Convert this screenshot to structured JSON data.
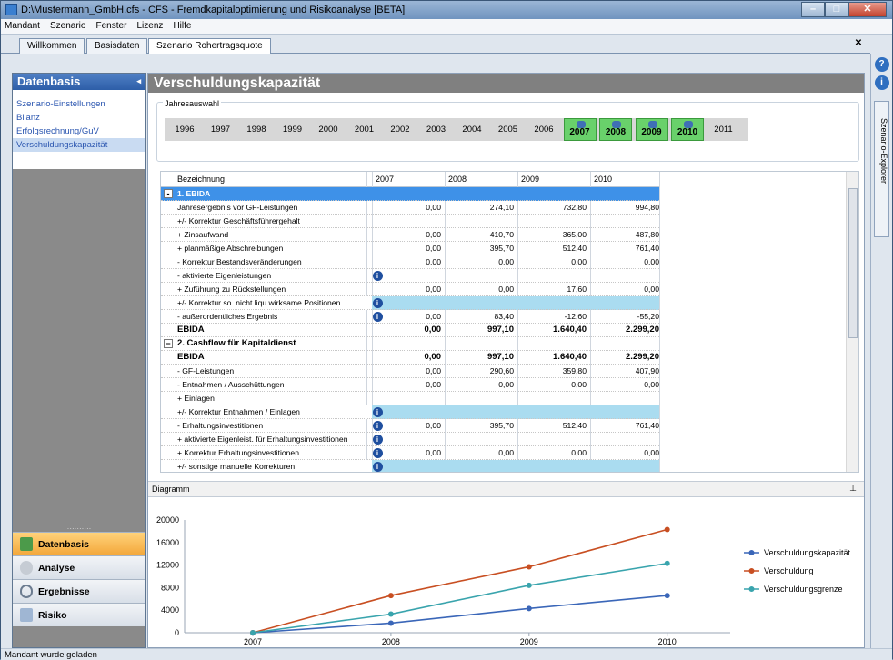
{
  "window": {
    "title": "D:\\Mustermann_GmbH.cfs - CFS - Fremdkapitaloptimierung und Risikoanalyse [BETA]"
  },
  "menu": [
    "Mandant",
    "Szenario",
    "Fenster",
    "Lizenz",
    "Hilfe"
  ],
  "tabs": [
    {
      "label": "Willkommen"
    },
    {
      "label": "Basisdaten"
    },
    {
      "label": "Szenario Rohertragsquote"
    }
  ],
  "right_rail": {
    "tab_label": "Szenario-Explorer"
  },
  "sidebar": {
    "title": "Datenbasis",
    "items": [
      "Szenario-Einstellungen",
      "Bilanz",
      "Erfolgsrechnung/GuV",
      "Verschuldungskapazität"
    ],
    "nav": [
      "Datenbasis",
      "Analyse",
      "Ergebnisse",
      "Risiko"
    ]
  },
  "main": {
    "title": "Verschuldungskapazität",
    "year_group_label": "Jahresauswahl",
    "years": [
      "1996",
      "1997",
      "1998",
      "1999",
      "2000",
      "2001",
      "2002",
      "2003",
      "2004",
      "2005",
      "2006",
      "2007",
      "2008",
      "2009",
      "2010",
      "2011"
    ],
    "selected_years": [
      "2007",
      "2008",
      "2009",
      "2010"
    ]
  },
  "grid": {
    "columns": [
      "Bezeichnung",
      "2007",
      "2008",
      "2009",
      "2010"
    ],
    "rows": [
      {
        "type": "group",
        "label": "1. EBIDA",
        "exp": "-"
      },
      {
        "label": "Jahresergebnis vor GF-Leistungen",
        "v": [
          "0,00",
          "274,10",
          "732,80",
          "994,80"
        ]
      },
      {
        "label": "+/- Korrektur Geschäftsführergehalt",
        "v": [
          "",
          "",
          "",
          ""
        ]
      },
      {
        "label": "+ Zinsaufwand",
        "v": [
          "0,00",
          "410,70",
          "365,00",
          "487,80"
        ]
      },
      {
        "label": "+ planmäßige Abschreibungen",
        "v": [
          "0,00",
          "395,70",
          "512,40",
          "761,40"
        ]
      },
      {
        "label": "- Korrektur Bestandsveränderungen",
        "v": [
          "0,00",
          "0,00",
          "0,00",
          "0,00"
        ]
      },
      {
        "label": "- aktivierte Eigenleistungen",
        "info": true,
        "v": [
          "",
          "",
          "",
          ""
        ]
      },
      {
        "label": "+ Zuführung zu Rückstellungen",
        "v": [
          "0,00",
          "0,00",
          "17,60",
          "0,00"
        ]
      },
      {
        "label": "+/- Korrektur so. nicht liqu.wirksame Positionen",
        "info": true,
        "blue": true,
        "v": [
          "",
          "",
          "",
          ""
        ]
      },
      {
        "label": "- außerordentliches Ergebnis",
        "info": true,
        "v": [
          "0,00",
          "83,40",
          "-12,60",
          "-55,20"
        ]
      },
      {
        "type": "bold",
        "label": "EBIDA",
        "v": [
          "0,00",
          "997,10",
          "1.640,40",
          "2.299,20"
        ]
      },
      {
        "type": "group2",
        "label": "2. Cashflow für Kapitaldienst",
        "exp": "−"
      },
      {
        "type": "bold",
        "label": "EBIDA",
        "v": [
          "0,00",
          "997,10",
          "1.640,40",
          "2.299,20"
        ]
      },
      {
        "label": "- GF-Leistungen",
        "v": [
          "0,00",
          "290,60",
          "359,80",
          "407,90"
        ]
      },
      {
        "label": "- Entnahmen / Ausschüttungen",
        "v": [
          "0,00",
          "0,00",
          "0,00",
          "0,00"
        ]
      },
      {
        "label": "+ Einlagen",
        "v": [
          "",
          "",
          "",
          ""
        ]
      },
      {
        "label": "+/- Korrektur Entnahmen / Einlagen",
        "info": true,
        "blue": true,
        "v": [
          "",
          "",
          "",
          ""
        ]
      },
      {
        "label": "- Erhaltungsinvestitionen",
        "info": true,
        "v": [
          "0,00",
          "395,70",
          "512,40",
          "761,40"
        ]
      },
      {
        "label": "+ aktivierte Eigenleist. für Erhaltungsinvestitionen",
        "info": true,
        "v": [
          "",
          "",
          "",
          ""
        ]
      },
      {
        "label": "+ Korrektur Erhaltungsinvestitionen",
        "info": true,
        "v": [
          "0,00",
          "0,00",
          "0,00",
          "0,00"
        ]
      },
      {
        "label": "+/- sonstige manuelle Korrekturen",
        "info": true,
        "blue": true,
        "v": [
          "",
          "",
          "",
          ""
        ]
      }
    ]
  },
  "diagram": {
    "label": "Diagramm"
  },
  "chart_data": {
    "type": "line",
    "x": [
      "2007",
      "2008",
      "2009",
      "2010"
    ],
    "ylim": [
      0,
      20000
    ],
    "yticks": [
      0,
      4000,
      8000,
      12000,
      16000,
      20000
    ],
    "series": [
      {
        "name": "Verschuldungskapazität",
        "color": "#3a66b8",
        "values": [
          0,
          1700,
          4300,
          6600
        ]
      },
      {
        "name": "Verschuldung",
        "color": "#c84f22",
        "values": [
          0,
          6600,
          11700,
          18300
        ]
      },
      {
        "name": "Verschuldungsgrenze",
        "color": "#39a4ad",
        "values": [
          0,
          3300,
          8400,
          12300
        ]
      }
    ],
    "legend": "right"
  },
  "status": "Mandant wurde geladen"
}
